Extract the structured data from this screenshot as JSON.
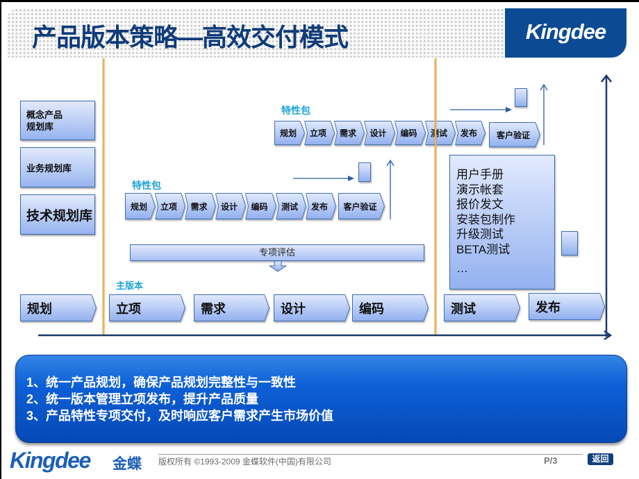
{
  "title": "产品版本策略—高效交付模式",
  "header_logo": "Kingdee",
  "libraries": [
    {
      "label": "概念产品\n规划库"
    },
    {
      "label": "业务规划库"
    },
    {
      "label": "技术规划库"
    }
  ],
  "feature_packages": [
    {
      "label": "特性包",
      "steps": [
        "规划",
        "立项",
        "需求",
        "设计",
        "编码",
        "测试",
        "发布"
      ],
      "verify": "客户验证"
    },
    {
      "label": "特性包",
      "steps": [
        "规划",
        "立项",
        "需求",
        "设计",
        "编码",
        "测试",
        "发布"
      ],
      "verify": "客户验证"
    }
  ],
  "evaluation": "专项评估",
  "main_version": {
    "label": "主版本",
    "stages": [
      "规划",
      "立项",
      "需求",
      "设计",
      "编码",
      "测试",
      "发布"
    ]
  },
  "deliverables": [
    "用户手册",
    "演示帐套",
    "报价发文",
    "安装包制作",
    "升级测试",
    "BETA测试",
    "…"
  ],
  "colors": {
    "brand_blue": "#0c4b94",
    "milestone_orange": "#e6a445",
    "accent_cyan": "#1ba3d6",
    "axis": "#1b3a6b"
  },
  "summary": [
    "1、统一产品规划，确保产品规划完整性与一致性",
    "2、统一版本管理立项发布，提升产品质量",
    "3、产品特性专项交付，及时响应客户需求产生市场价值"
  ],
  "footer": {
    "logo": "Kingdee",
    "logo_cn": "金蝶",
    "copyright": "版权所有 ©1993-2009 金蝶软件(中国)有限公司",
    "page": "P/3",
    "back": "返回"
  }
}
